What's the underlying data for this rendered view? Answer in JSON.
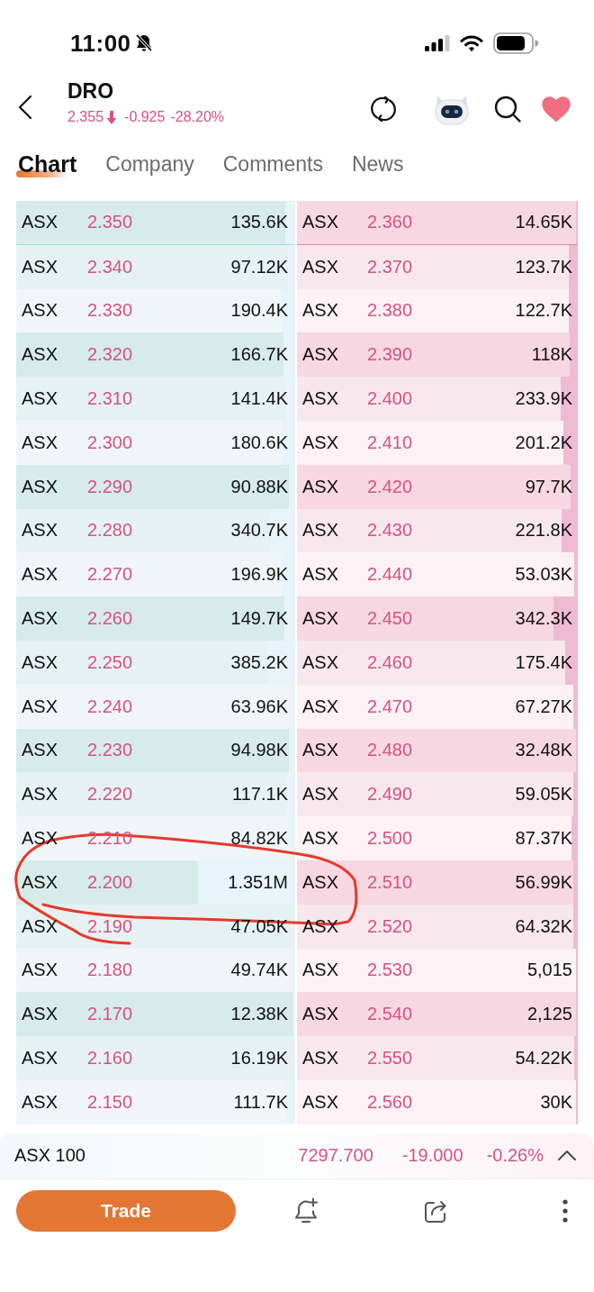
{
  "status_bar": {
    "time": "11:00"
  },
  "header": {
    "symbol": "DRO",
    "price": "2.355",
    "falling": true,
    "change": "-0.925",
    "change_pct": "-28.20%",
    "favorite": true
  },
  "tabs": [
    {
      "label": "Chart",
      "selected": true
    },
    {
      "label": "Company",
      "selected": false
    },
    {
      "label": "Comments",
      "selected": false
    },
    {
      "label": "News",
      "selected": false
    }
  ],
  "order_book": {
    "bids": [
      {
        "exchange": "ASX",
        "price": "2.350",
        "volume": "135.6K",
        "level": 0.035,
        "color": "#d7ebe9"
      },
      {
        "exchange": "ASX",
        "price": "2.340",
        "volume": "97.12K",
        "level": 0.025,
        "color": "#e6f2f1"
      },
      {
        "exchange": "ASX",
        "price": "2.330",
        "volume": "190.4K",
        "level": 0.049,
        "color": "#f0f6f7"
      },
      {
        "exchange": "ASX",
        "price": "2.320",
        "volume": "166.7K",
        "level": 0.043,
        "color": "#d7ebe9"
      },
      {
        "exchange": "ASX",
        "price": "2.310",
        "volume": "141.4K",
        "level": 0.036,
        "color": "#e6f2f1"
      },
      {
        "exchange": "ASX",
        "price": "2.300",
        "volume": "180.6K",
        "level": 0.046,
        "color": "#f0f6f7"
      },
      {
        "exchange": "ASX",
        "price": "2.290",
        "volume": "90.88K",
        "level": 0.023,
        "color": "#d7ebe9"
      },
      {
        "exchange": "ASX",
        "price": "2.280",
        "volume": "340.7K",
        "level": 0.088,
        "color": "#e6f2f1"
      },
      {
        "exchange": "ASX",
        "price": "2.270",
        "volume": "196.9K",
        "level": 0.051,
        "color": "#f0f6f7"
      },
      {
        "exchange": "ASX",
        "price": "2.260",
        "volume": "149.7K",
        "level": 0.038,
        "color": "#d7ebe9"
      },
      {
        "exchange": "ASX",
        "price": "2.250",
        "volume": "385.2K",
        "level": 0.099,
        "color": "#e6f2f1"
      },
      {
        "exchange": "ASX",
        "price": "2.240",
        "volume": "63.96K",
        "level": 0.016,
        "color": "#f0f6f7"
      },
      {
        "exchange": "ASX",
        "price": "2.230",
        "volume": "94.98K",
        "level": 0.024,
        "color": "#d7ebe9"
      },
      {
        "exchange": "ASX",
        "price": "2.220",
        "volume": "117.1K",
        "level": 0.03,
        "color": "#e6f2f1"
      },
      {
        "exchange": "ASX",
        "price": "2.210",
        "volume": "84.82K",
        "level": 0.022,
        "color": "#f0f6f7"
      },
      {
        "exchange": "ASX",
        "price": "2.200",
        "volume": "1.351M",
        "level": 0.347,
        "color": "#d7ebe9"
      },
      {
        "exchange": "ASX",
        "price": "2.190",
        "volume": "47.05K",
        "level": 0.012,
        "color": "#e6f2f1"
      },
      {
        "exchange": "ASX",
        "price": "2.180",
        "volume": "49.74K",
        "level": 0.013,
        "color": "#f0f6f7"
      },
      {
        "exchange": "ASX",
        "price": "2.170",
        "volume": "12.38K",
        "level": 0.003,
        "color": "#d7ebe9"
      },
      {
        "exchange": "ASX",
        "price": "2.160",
        "volume": "16.19K",
        "level": 0.004,
        "color": "#e6f2f1"
      },
      {
        "exchange": "ASX",
        "price": "2.150",
        "volume": "111.7K",
        "level": 0.029,
        "color": "#f0f6f7"
      }
    ],
    "asks": [
      {
        "exchange": "ASX",
        "price": "2.360",
        "volume": "14.65K",
        "level": 0.004,
        "color": "#f7d8e2"
      },
      {
        "exchange": "ASX",
        "price": "2.370",
        "volume": "123.7K",
        "level": 0.032,
        "color": "#f9e7ee"
      },
      {
        "exchange": "ASX",
        "price": "2.380",
        "volume": "122.7K",
        "level": 0.032,
        "color": "#fcf1f5"
      },
      {
        "exchange": "ASX",
        "price": "2.390",
        "volume": "118K",
        "level": 0.03,
        "color": "#f7d8e2"
      },
      {
        "exchange": "ASX",
        "price": "2.400",
        "volume": "233.9K",
        "level": 0.06,
        "color": "#f9e7ee"
      },
      {
        "exchange": "ASX",
        "price": "2.410",
        "volume": "201.2K",
        "level": 0.052,
        "color": "#fcf1f5"
      },
      {
        "exchange": "ASX",
        "price": "2.420",
        "volume": "97.7K",
        "level": 0.025,
        "color": "#f7d8e2"
      },
      {
        "exchange": "ASX",
        "price": "2.430",
        "volume": "221.8K",
        "level": 0.057,
        "color": "#f9e7ee"
      },
      {
        "exchange": "ASX",
        "price": "2.440",
        "volume": "53.03K",
        "level": 0.014,
        "color": "#fcf1f5"
      },
      {
        "exchange": "ASX",
        "price": "2.450",
        "volume": "342.3K",
        "level": 0.088,
        "color": "#f7d8e2"
      },
      {
        "exchange": "ASX",
        "price": "2.460",
        "volume": "175.4K",
        "level": 0.045,
        "color": "#f9e7ee"
      },
      {
        "exchange": "ASX",
        "price": "2.470",
        "volume": "67.27K",
        "level": 0.017,
        "color": "#fcf1f5"
      },
      {
        "exchange": "ASX",
        "price": "2.480",
        "volume": "32.48K",
        "level": 0.008,
        "color": "#f7d8e2"
      },
      {
        "exchange": "ASX",
        "price": "2.490",
        "volume": "59.05K",
        "level": 0.015,
        "color": "#f9e7ee"
      },
      {
        "exchange": "ASX",
        "price": "2.500",
        "volume": "87.37K",
        "level": 0.022,
        "color": "#fcf1f5"
      },
      {
        "exchange": "ASX",
        "price": "2.510",
        "volume": "56.99K",
        "level": 0.015,
        "color": "#f7d8e2"
      },
      {
        "exchange": "ASX",
        "price": "2.520",
        "volume": "64.32K",
        "level": 0.017,
        "color": "#f9e7ee"
      },
      {
        "exchange": "ASX",
        "price": "2.530",
        "volume": "5,015",
        "level": 0.001,
        "color": "#fcf1f5"
      },
      {
        "exchange": "ASX",
        "price": "2.540",
        "volume": "2,125",
        "level": 0.001,
        "color": "#f7d8e2"
      },
      {
        "exchange": "ASX",
        "price": "2.550",
        "volume": "54.22K",
        "level": 0.014,
        "color": "#f9e7ee"
      },
      {
        "exchange": "ASX",
        "price": "2.560",
        "volume": "30K",
        "level": 0.008,
        "color": "#fcf1f5"
      }
    ]
  },
  "index_bar": {
    "name": "ASX 100",
    "value": "7297.700",
    "change": "-19.000",
    "change_pct": "-0.26%",
    "expanded": false
  },
  "actions": {
    "trade_button": "Trade"
  }
}
